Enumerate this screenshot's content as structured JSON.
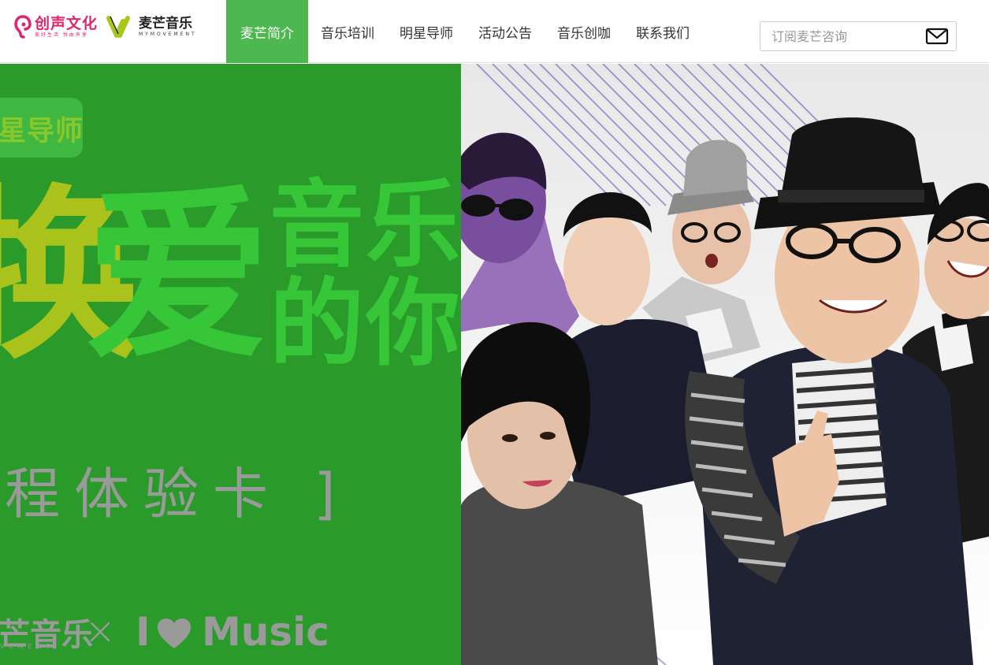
{
  "header": {
    "logo_primary": {
      "name": "创声文化",
      "slogan": "美好生活  悦由声享"
    },
    "logo_secondary": {
      "name": "麦芒音乐",
      "sub": "MYMOVEMENT"
    }
  },
  "nav": {
    "items": [
      {
        "label": "麦芒简介",
        "active": true
      },
      {
        "label": "音乐培训",
        "active": false
      },
      {
        "label": "明星导师",
        "active": false
      },
      {
        "label": "活动公告",
        "active": false
      },
      {
        "label": "音乐创咖",
        "active": false
      },
      {
        "label": "联系我们",
        "active": false
      }
    ]
  },
  "subscribe": {
    "placeholder": "订阅麦芒咨询",
    "icon": "mail-icon"
  },
  "banner": {
    "tag": "星导师",
    "title_chars": [
      "换",
      "爱",
      "音乐",
      "的你"
    ],
    "course_text": "程体验卡 ]",
    "brand_left": "芒音乐",
    "brand_left_sub": "VEMENT",
    "brand_x": "×",
    "brand_right_i": "I",
    "brand_right_music": "Music",
    "colors": {
      "green_dark": "#2a9b2b",
      "green_light": "#36c637",
      "lime": "#a9c21c",
      "gray_text": "#9a9a9a",
      "stripe_purple": "#6b4fa0"
    }
  },
  "colors": {
    "nav_active_bg": "#4cb84f",
    "brand_pink": "#e0246b"
  }
}
